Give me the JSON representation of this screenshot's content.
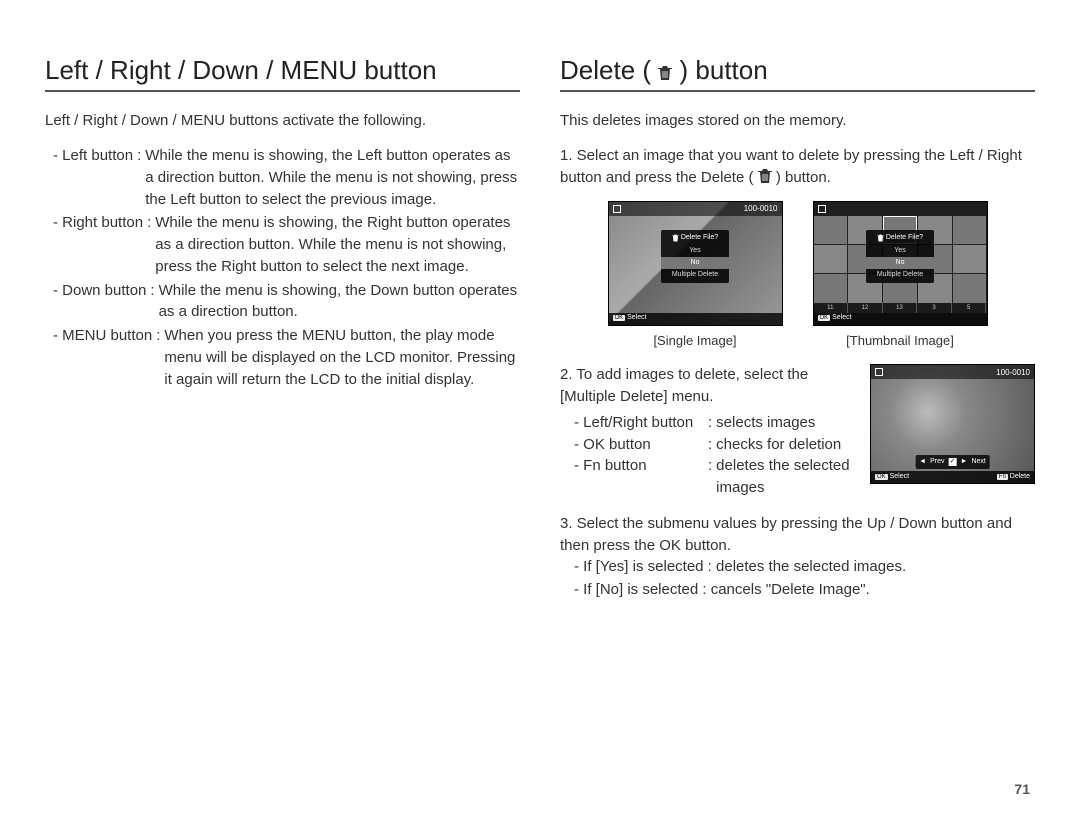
{
  "page_number": "71",
  "left": {
    "heading": "Left / Right / Down / MENU button",
    "intro": "Left / Right / Down / MENU buttons activate the following.",
    "items": [
      {
        "label": "- Left button",
        "body": "While the menu is showing, the Left button operates as a direction button. While the menu is not showing, press the Left button to select the previous image."
      },
      {
        "label": "- Right button",
        "body": "While the menu is showing, the Right button operates as a direction button. While the menu is not showing, press the Right button to select the next image."
      },
      {
        "label": "- Down button",
        "body": "While the menu is showing, the Down button operates as a direction button."
      },
      {
        "label": "- MENU button",
        "body": "When you press the MENU button, the play mode menu will be displayed on the LCD monitor. Pressing it again will return the LCD to the initial display."
      }
    ]
  },
  "right": {
    "heading_pre": "Delete (",
    "heading_post": ") button",
    "intro": "This deletes images stored on the memory.",
    "step1_pre": "1. Select an image that you want to delete by pressing the Left / Right button and press the Delete (",
    "step1_post": ") button.",
    "lcd": {
      "file_no": "100-0010",
      "dialog_title": "Delete File?",
      "opt_yes": "Yes",
      "opt_no": "No",
      "opt_multi": "Multiple Delete",
      "ok": "OK",
      "select": "Select",
      "fn": "Fn",
      "delete": "Delete",
      "prev": "Prev",
      "next": "Next"
    },
    "caption_single": "[Single Image]",
    "caption_thumb": "[Thumbnail Image]",
    "step2": "2. To add images to delete, select the [Multiple Delete] menu.",
    "step2_items": [
      {
        "label": "- Left/Right button",
        "body": "selects images"
      },
      {
        "label": "- OK button",
        "body": "checks for deletion"
      },
      {
        "label": "- Fn button",
        "body": "deletes the selected images"
      }
    ],
    "step3": "3. Select the submenu values by pressing the Up / Down button and then press the OK button.",
    "step3_yes": "- If [Yes] is selected : deletes the selected images.",
    "step3_no": "- If [No] is selected   : cancels \"Delete Image\"."
  }
}
